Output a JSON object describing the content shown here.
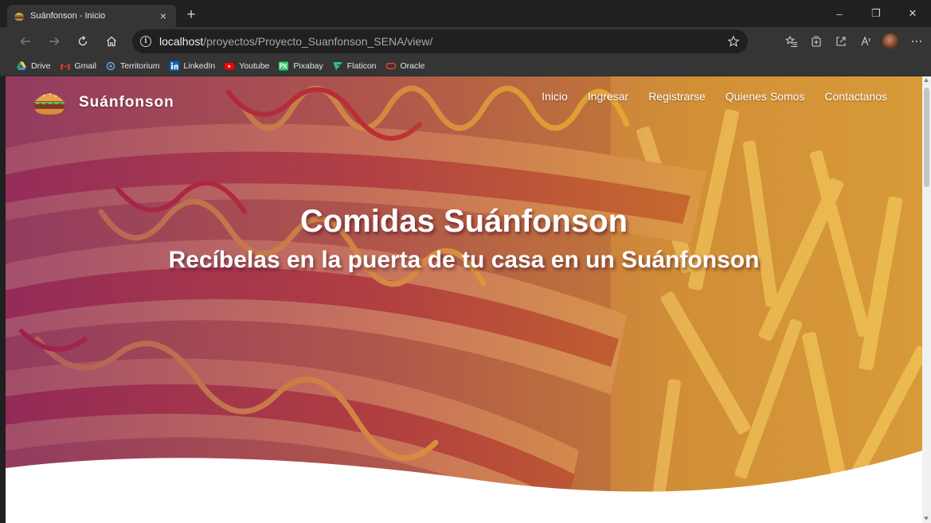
{
  "browser": {
    "tab": {
      "title": "Suánfonson - Inicio",
      "close": "×"
    },
    "new_tab": "+",
    "window_controls": {
      "minimize": "–",
      "restore": "❐",
      "close": "✕"
    },
    "url_host": "localhost",
    "url_path": "/proyectos/Proyecto_Suanfonson_SENA/view/",
    "info_glyph": "i",
    "bookmarks": [
      {
        "label": "Drive",
        "icon": "drive-icon"
      },
      {
        "label": "Gmail",
        "icon": "gmail-icon"
      },
      {
        "label": "Territorium",
        "icon": "territorium-icon"
      },
      {
        "label": "LinkedIn",
        "icon": "linkedin-icon"
      },
      {
        "label": "Youtube",
        "icon": "youtube-icon"
      },
      {
        "label": "Pixabay",
        "icon": "pixabay-icon"
      },
      {
        "label": "Flaticon",
        "icon": "flaticon-icon"
      },
      {
        "label": "Oracle",
        "icon": "oracle-icon"
      }
    ]
  },
  "site": {
    "brand": "Suánfonson",
    "nav": [
      "Inicio",
      "Ingresar",
      "Registrarse",
      "Quienes Somos",
      "Contactanos"
    ],
    "hero": {
      "title": "Comidas Suánfonson",
      "subtitle": "Recíbelas en la puerta de tu casa en un Suánfonson"
    }
  },
  "colors": {
    "tint_left": "#801e6e",
    "tint_right": "#e6aa28",
    "browser_chrome": "#353535"
  }
}
